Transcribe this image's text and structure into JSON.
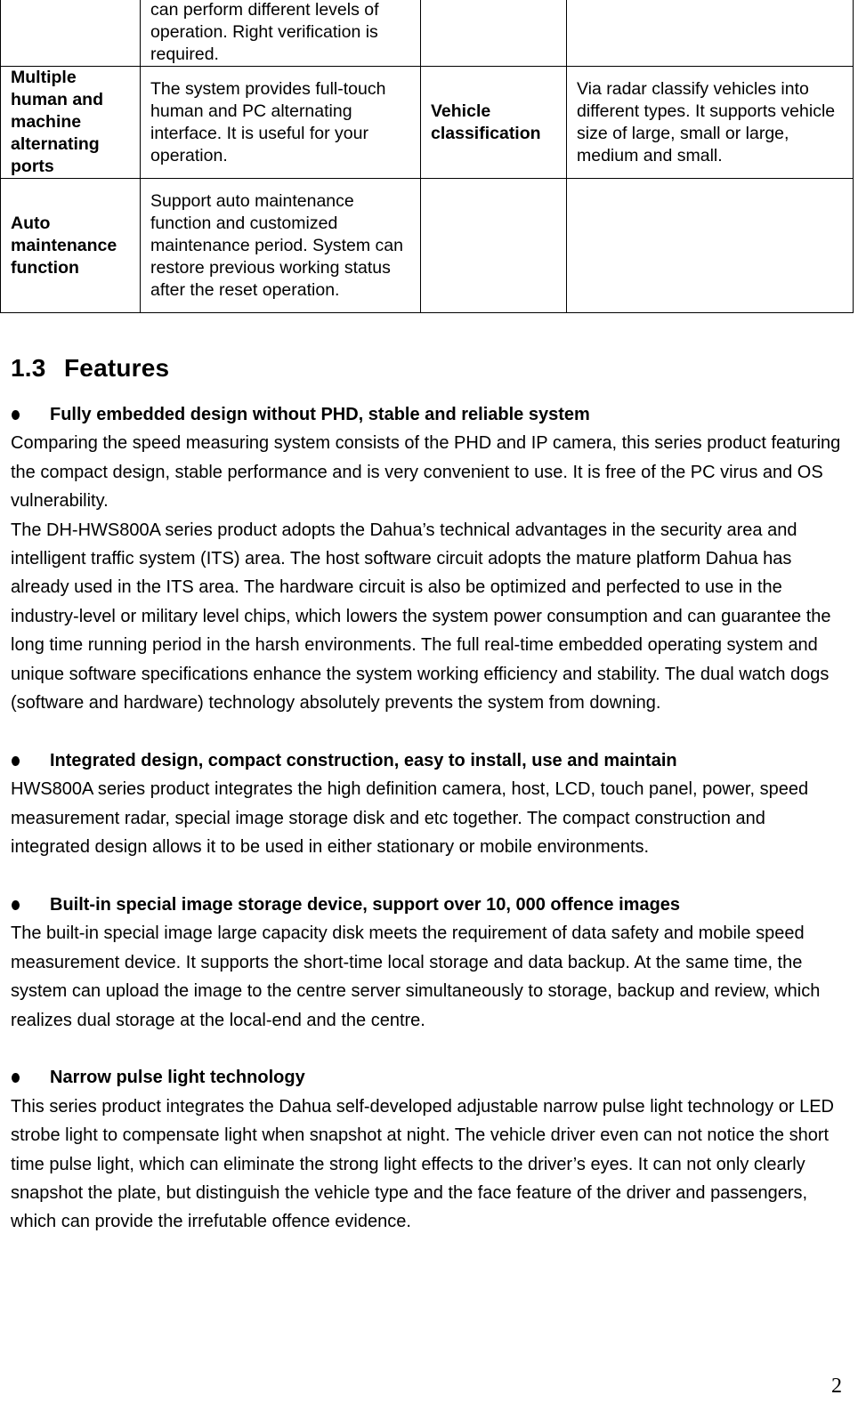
{
  "table": {
    "rows": [
      {
        "c1": "",
        "c2": "can perform different levels of operation. Right verification is required.",
        "c3": "",
        "c4": ""
      },
      {
        "c1": "Multiple human and machine alternating ports",
        "c2": "The system provides full-touch human and PC alternating interface. It is useful for your operation.",
        "c3": "Vehicle classification",
        "c4": "Via radar classify vehicles into different types. It supports vehicle size of large, small or large, medium and small."
      },
      {
        "c1": "Auto maintenance function",
        "c2": "Support auto maintenance function and customized maintenance period. System can restore previous working status after the reset operation.",
        "c3": "",
        "c4": ""
      }
    ]
  },
  "section": {
    "number": "1.3",
    "title": "Features"
  },
  "features": [
    {
      "heading": "Fully embedded design without PHD, stable and reliable system",
      "paragraphs": [
        "Comparing the speed measuring system consists of the PHD and IP camera, this series product featuring the compact design, stable performance and is very convenient to use. It is free of the PC virus and OS vulnerability.",
        "The DH-HWS800A series product adopts the Dahua’s technical advantages in the security area and intelligent traffic system (ITS) area. The host software circuit adopts the mature platform Dahua has already used in the ITS area.  The hardware circuit is also be optimized and perfected  to use in the industry-level or military level chips, which lowers the system power consumption and can guarantee the long time running period in the harsh environments. The full real-time embedded operating system and unique software specifications enhance the system working efficiency and stability. The dual watch dogs (software and hardware) technology absolutely prevents the system from downing."
      ]
    },
    {
      "heading": "Integrated design, compact construction, easy to install, use and maintain",
      "paragraphs": [
        "HWS800A series product integrates the high definition camera, host, LCD, touch panel, power, speed measurement radar, special image storage disk and etc together. The compact construction and integrated design allows it to be used in either stationary or mobile environments."
      ]
    },
    {
      "heading": "Built-in special image storage device, support over 10, 000 offence images",
      "paragraphs": [
        "The built-in special image large capacity disk meets the requirement of data safety and mobile speed measurement device. It supports the short-time local storage and data backup.  At the same time, the system can upload the image to the centre server simultaneously to storage, backup and review, which realizes dual storage at the local-end and the centre."
      ]
    },
    {
      "heading": "Narrow pulse light technology",
      "paragraphs": [
        "This series product integrates the Dahua self-developed adjustable narrow pulse light technology or LED strobe light to compensate light when snapshot at night. The vehicle driver even can not notice the short time pulse light, which can eliminate the strong light effects to the driver’s eyes. It can not only clearly snapshot the plate, but distinguish the vehicle type and the face feature of the driver and passengers, which can provide the irrefutable offence evidence."
      ]
    }
  ],
  "page_number": "2"
}
